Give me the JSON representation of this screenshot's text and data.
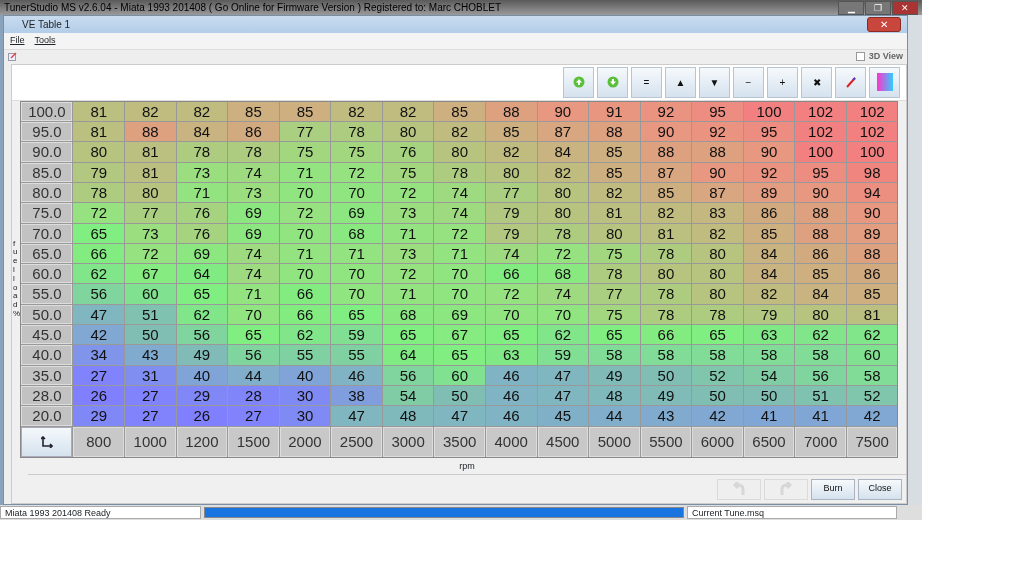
{
  "app_title": "TunerStudio MS v2.6.04 - Miata 1993 201408 ( Go Online for Firmware Version ) Registered to: Marc CHOBLET",
  "window_controls": [
    "▁",
    "❐",
    "✕"
  ],
  "dialog": {
    "title": "VE Table 1",
    "close": "✕",
    "menus": [
      "File",
      "Tools"
    ],
    "view_3d": {
      "label": "3D View",
      "checked": false
    },
    "toolbar": [
      {
        "kind": "up"
      },
      {
        "kind": "down"
      },
      {
        "kind": "glyph",
        "text": "="
      },
      {
        "kind": "glyph",
        "text": "▲"
      },
      {
        "kind": "glyph",
        "text": "▼"
      },
      {
        "kind": "glyph",
        "text": "−"
      },
      {
        "kind": "glyph",
        "text": "+"
      },
      {
        "kind": "glyph",
        "text": "✖"
      },
      {
        "kind": "pen"
      },
      {
        "kind": "colors"
      }
    ],
    "y_axis_label": "fuel load %",
    "rows": [
      {
        "load": "100.0",
        "values": [
          "81",
          "82",
          "82",
          "85",
          "85",
          "82",
          "82",
          "85",
          "88",
          "90",
          "91",
          "92",
          "95",
          "100",
          "102",
          "102"
        ]
      },
      {
        "load": "95.0",
        "values": [
          "81",
          "88",
          "84",
          "86",
          "77",
          "78",
          "80",
          "82",
          "85",
          "87",
          "88",
          "90",
          "92",
          "95",
          "102",
          "102"
        ]
      },
      {
        "load": "90.0",
        "values": [
          "80",
          "81",
          "78",
          "78",
          "75",
          "75",
          "76",
          "80",
          "82",
          "84",
          "85",
          "88",
          "88",
          "90",
          "100",
          "100"
        ]
      },
      {
        "load": "85.0",
        "values": [
          "79",
          "81",
          "73",
          "74",
          "71",
          "72",
          "75",
          "78",
          "80",
          "82",
          "85",
          "87",
          "90",
          "92",
          "95",
          "98"
        ]
      },
      {
        "load": "80.0",
        "values": [
          "78",
          "80",
          "71",
          "73",
          "70",
          "70",
          "72",
          "74",
          "77",
          "80",
          "82",
          "85",
          "87",
          "89",
          "90",
          "94"
        ]
      },
      {
        "load": "75.0",
        "values": [
          "72",
          "77",
          "76",
          "69",
          "72",
          "69",
          "73",
          "74",
          "79",
          "80",
          "81",
          "82",
          "83",
          "86",
          "88",
          "90"
        ]
      },
      {
        "load": "70.0",
        "values": [
          "65",
          "73",
          "76",
          "69",
          "70",
          "68",
          "71",
          "72",
          "79",
          "78",
          "80",
          "81",
          "82",
          "85",
          "88",
          "89"
        ]
      },
      {
        "load": "65.0",
        "values": [
          "66",
          "72",
          "69",
          "74",
          "71",
          "71",
          "73",
          "71",
          "74",
          "72",
          "75",
          "78",
          "80",
          "84",
          "86",
          "88"
        ]
      },
      {
        "load": "60.0",
        "values": [
          "62",
          "67",
          "64",
          "74",
          "70",
          "70",
          "72",
          "70",
          "66",
          "68",
          "78",
          "80",
          "80",
          "84",
          "85",
          "86"
        ]
      },
      {
        "load": "55.0",
        "values": [
          "56",
          "60",
          "65",
          "71",
          "66",
          "70",
          "71",
          "70",
          "72",
          "74",
          "77",
          "78",
          "80",
          "82",
          "84",
          "85"
        ]
      },
      {
        "load": "50.0",
        "values": [
          "47",
          "51",
          "62",
          "70",
          "66",
          "65",
          "68",
          "69",
          "70",
          "70",
          "75",
          "78",
          "78",
          "79",
          "80",
          "81"
        ]
      },
      {
        "load": "45.0",
        "values": [
          "42",
          "50",
          "56",
          "65",
          "62",
          "59",
          "65",
          "67",
          "65",
          "62",
          "65",
          "66",
          "65",
          "63",
          "62",
          "62"
        ]
      },
      {
        "load": "40.0",
        "values": [
          "34",
          "43",
          "49",
          "56",
          "55",
          "55",
          "64",
          "65",
          "63",
          "59",
          "58",
          "58",
          "58",
          "58",
          "58",
          "60"
        ]
      },
      {
        "load": "35.0",
        "values": [
          "27",
          "31",
          "40",
          "44",
          "40",
          "46",
          "56",
          "60",
          "46",
          "47",
          "49",
          "50",
          "52",
          "54",
          "56",
          "58"
        ]
      },
      {
        "load": "28.0",
        "values": [
          "26",
          "27",
          "29",
          "28",
          "30",
          "38",
          "54",
          "50",
          "46",
          "47",
          "48",
          "49",
          "50",
          "50",
          "51",
          "52"
        ]
      },
      {
        "load": "20.0",
        "values": [
          "29",
          "27",
          "26",
          "27",
          "30",
          "47",
          "48",
          "47",
          "46",
          "45",
          "44",
          "43",
          "42",
          "41",
          "41",
          "42"
        ]
      }
    ],
    "rpm": [
      "800",
      "1000",
      "1200",
      "1500",
      "2000",
      "2500",
      "3000",
      "3500",
      "4000",
      "4500",
      "5000",
      "5500",
      "6000",
      "6500",
      "7000",
      "7500"
    ],
    "x_axis_label": "rpm",
    "buttons": [
      {
        "kind": "undo",
        "disabled": true
      },
      {
        "kind": "redo",
        "disabled": true
      },
      {
        "kind": "text",
        "label": "Burn",
        "disabled": false
      },
      {
        "kind": "text",
        "label": "Close",
        "disabled": false
      }
    ]
  },
  "status_bar": {
    "left": "Miata 1993 201408 Ready",
    "progress": {
      "level": 1
    },
    "right": "Current Tune.msq"
  }
}
